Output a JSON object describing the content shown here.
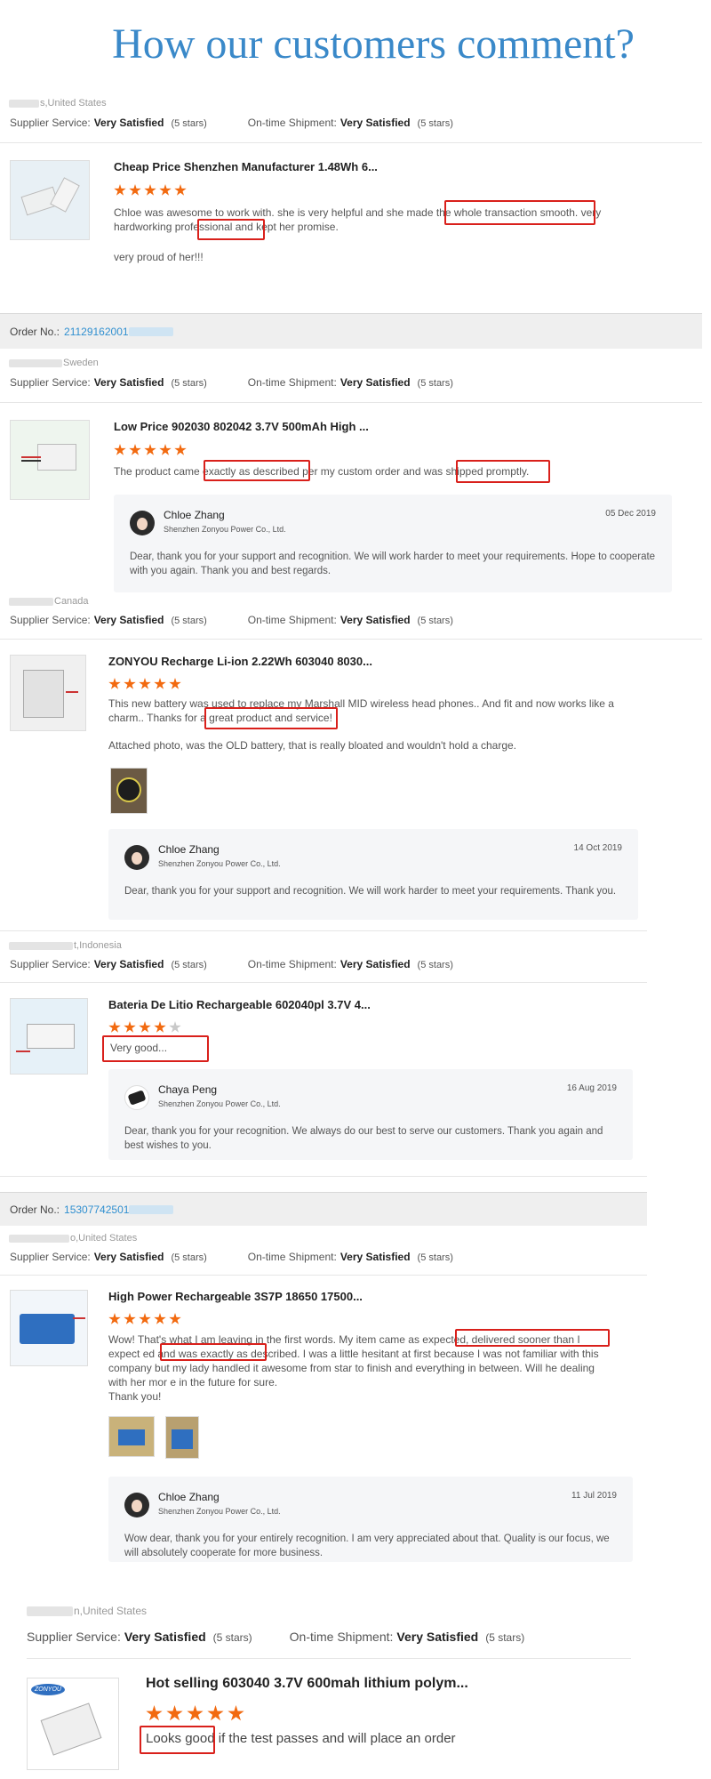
{
  "title": "How our customers comment?",
  "ratings_labels": {
    "supplier": "Supplier Service:",
    "shipment": "On-time Shipment:",
    "value": "Very Satisfied",
    "stars": "(5 stars)"
  },
  "order_label": "Order No.:",
  "reviews": [
    {
      "country": "s,United States",
      "product": "Cheap Price Shenzhen Manufacturer 1.48Wh 6...",
      "stars": 5,
      "text": "Chloe was awesome to work with. she is very helpful and she made the whole transaction smooth. very hardworking professional and kept her promise.",
      "text2": "very proud of her!!!"
    },
    {
      "order_no": "21129162001",
      "country": "Sweden",
      "product": "Low Price 902030 802042 3.7V 500mAh High ...",
      "stars": 5,
      "text": "The product came exactly as described per my custom order and was shipped promptly.",
      "reply": {
        "name": "Chloe Zhang",
        "company": "Shenzhen Zonyou Power Co., Ltd.",
        "date": "05 Dec 2019",
        "message": "Dear, thank you for your support and recognition. We will work harder to meet your requirements. Hope to cooperate with you again. Thank you and best regards."
      }
    },
    {
      "country": "Canada",
      "product": "ZONYOU Recharge Li-ion 2.22Wh 603040 8030...",
      "stars": 5,
      "text": "This new battery was used to replace my Marshall MID wireless head phones.. And fit and now works like a charm.. Thanks for a great product and service!",
      "text2": "Attached photo, was the OLD battery, that is really bloated and wouldn't hold a charge.",
      "reply": {
        "name": "Chloe Zhang",
        "company": "Shenzhen Zonyou Power Co., Ltd.",
        "date": "14 Oct 2019",
        "message": "Dear, thank you for your support and recognition. We will work harder to meet your requirements. Thank you."
      }
    },
    {
      "country": "t,Indonesia",
      "product": "Bateria De Litio Rechargeable 602040pl 3.7V 4...",
      "stars": 4,
      "text": "Very good...",
      "reply": {
        "name": "Chaya Peng",
        "company": "Shenzhen Zonyou Power Co., Ltd.",
        "date": "16 Aug 2019",
        "message": "Dear, thank you for your recognition. We always do our best to serve our customers. Thank you again and best wishes to you."
      }
    },
    {
      "order_no": "15307742501",
      "country": "o,United States",
      "product": "High Power Rechargeable 3S7P 18650 17500...",
      "stars": 5,
      "text": "Wow! That's what I am leaving in the first words. My item came as expected, delivered sooner than I expect ed and was exactly as described. I was a little hesitant at first because I was not familiar with this company but my lady handled it awesome from star to finish and everything in between. Will he dealing with her mor e in the future for sure.",
      "text2": "Thank you!",
      "reply": {
        "name": "Chloe Zhang",
        "company": "Shenzhen Zonyou Power Co., Ltd.",
        "date": "11 Jul 2019",
        "message": "Wow dear, thank you for your entirely recognition. I am very appreciated about that. Quality is our focus, we will absolutely cooperate for more business."
      }
    },
    {
      "country": "n,United States",
      "product": "Hot selling 603040 3.7V 600mah lithium polym...",
      "stars": 5,
      "text": "Looks good if the test passes and will place an order",
      "logo": "ZONYOU"
    }
  ]
}
